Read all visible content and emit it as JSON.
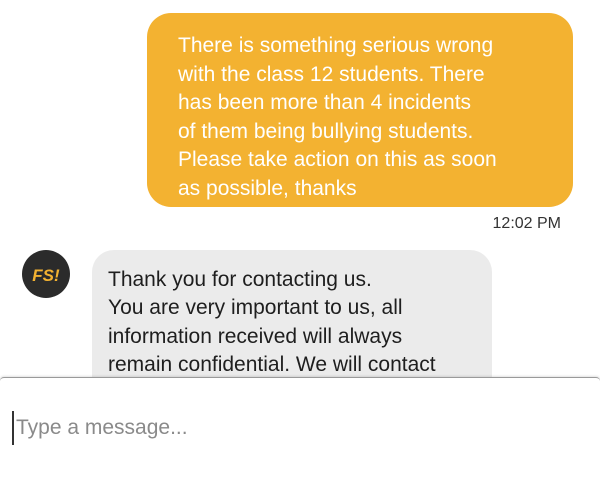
{
  "conversation": {
    "outgoing": {
      "text": "There is something serious wrong\nwith the class 12 students. There\nhas been more than 4 incidents\nof them being bullying students.\nPlease take action on this as soon\nas possible, thanks",
      "time": "12:02 PM"
    },
    "incoming": {
      "avatar_label": "FS!",
      "text": "Thank you for contacting us.\nYou are very important to us, all\ninformation received will always\nremain confidential. We will contact"
    }
  },
  "composer": {
    "placeholder": "Type a message..."
  },
  "colors": {
    "outgoing_bubble": "#f3b231",
    "incoming_bubble": "#ebebeb",
    "avatar_bg": "#2b2b2b",
    "avatar_text": "#f3b231"
  }
}
